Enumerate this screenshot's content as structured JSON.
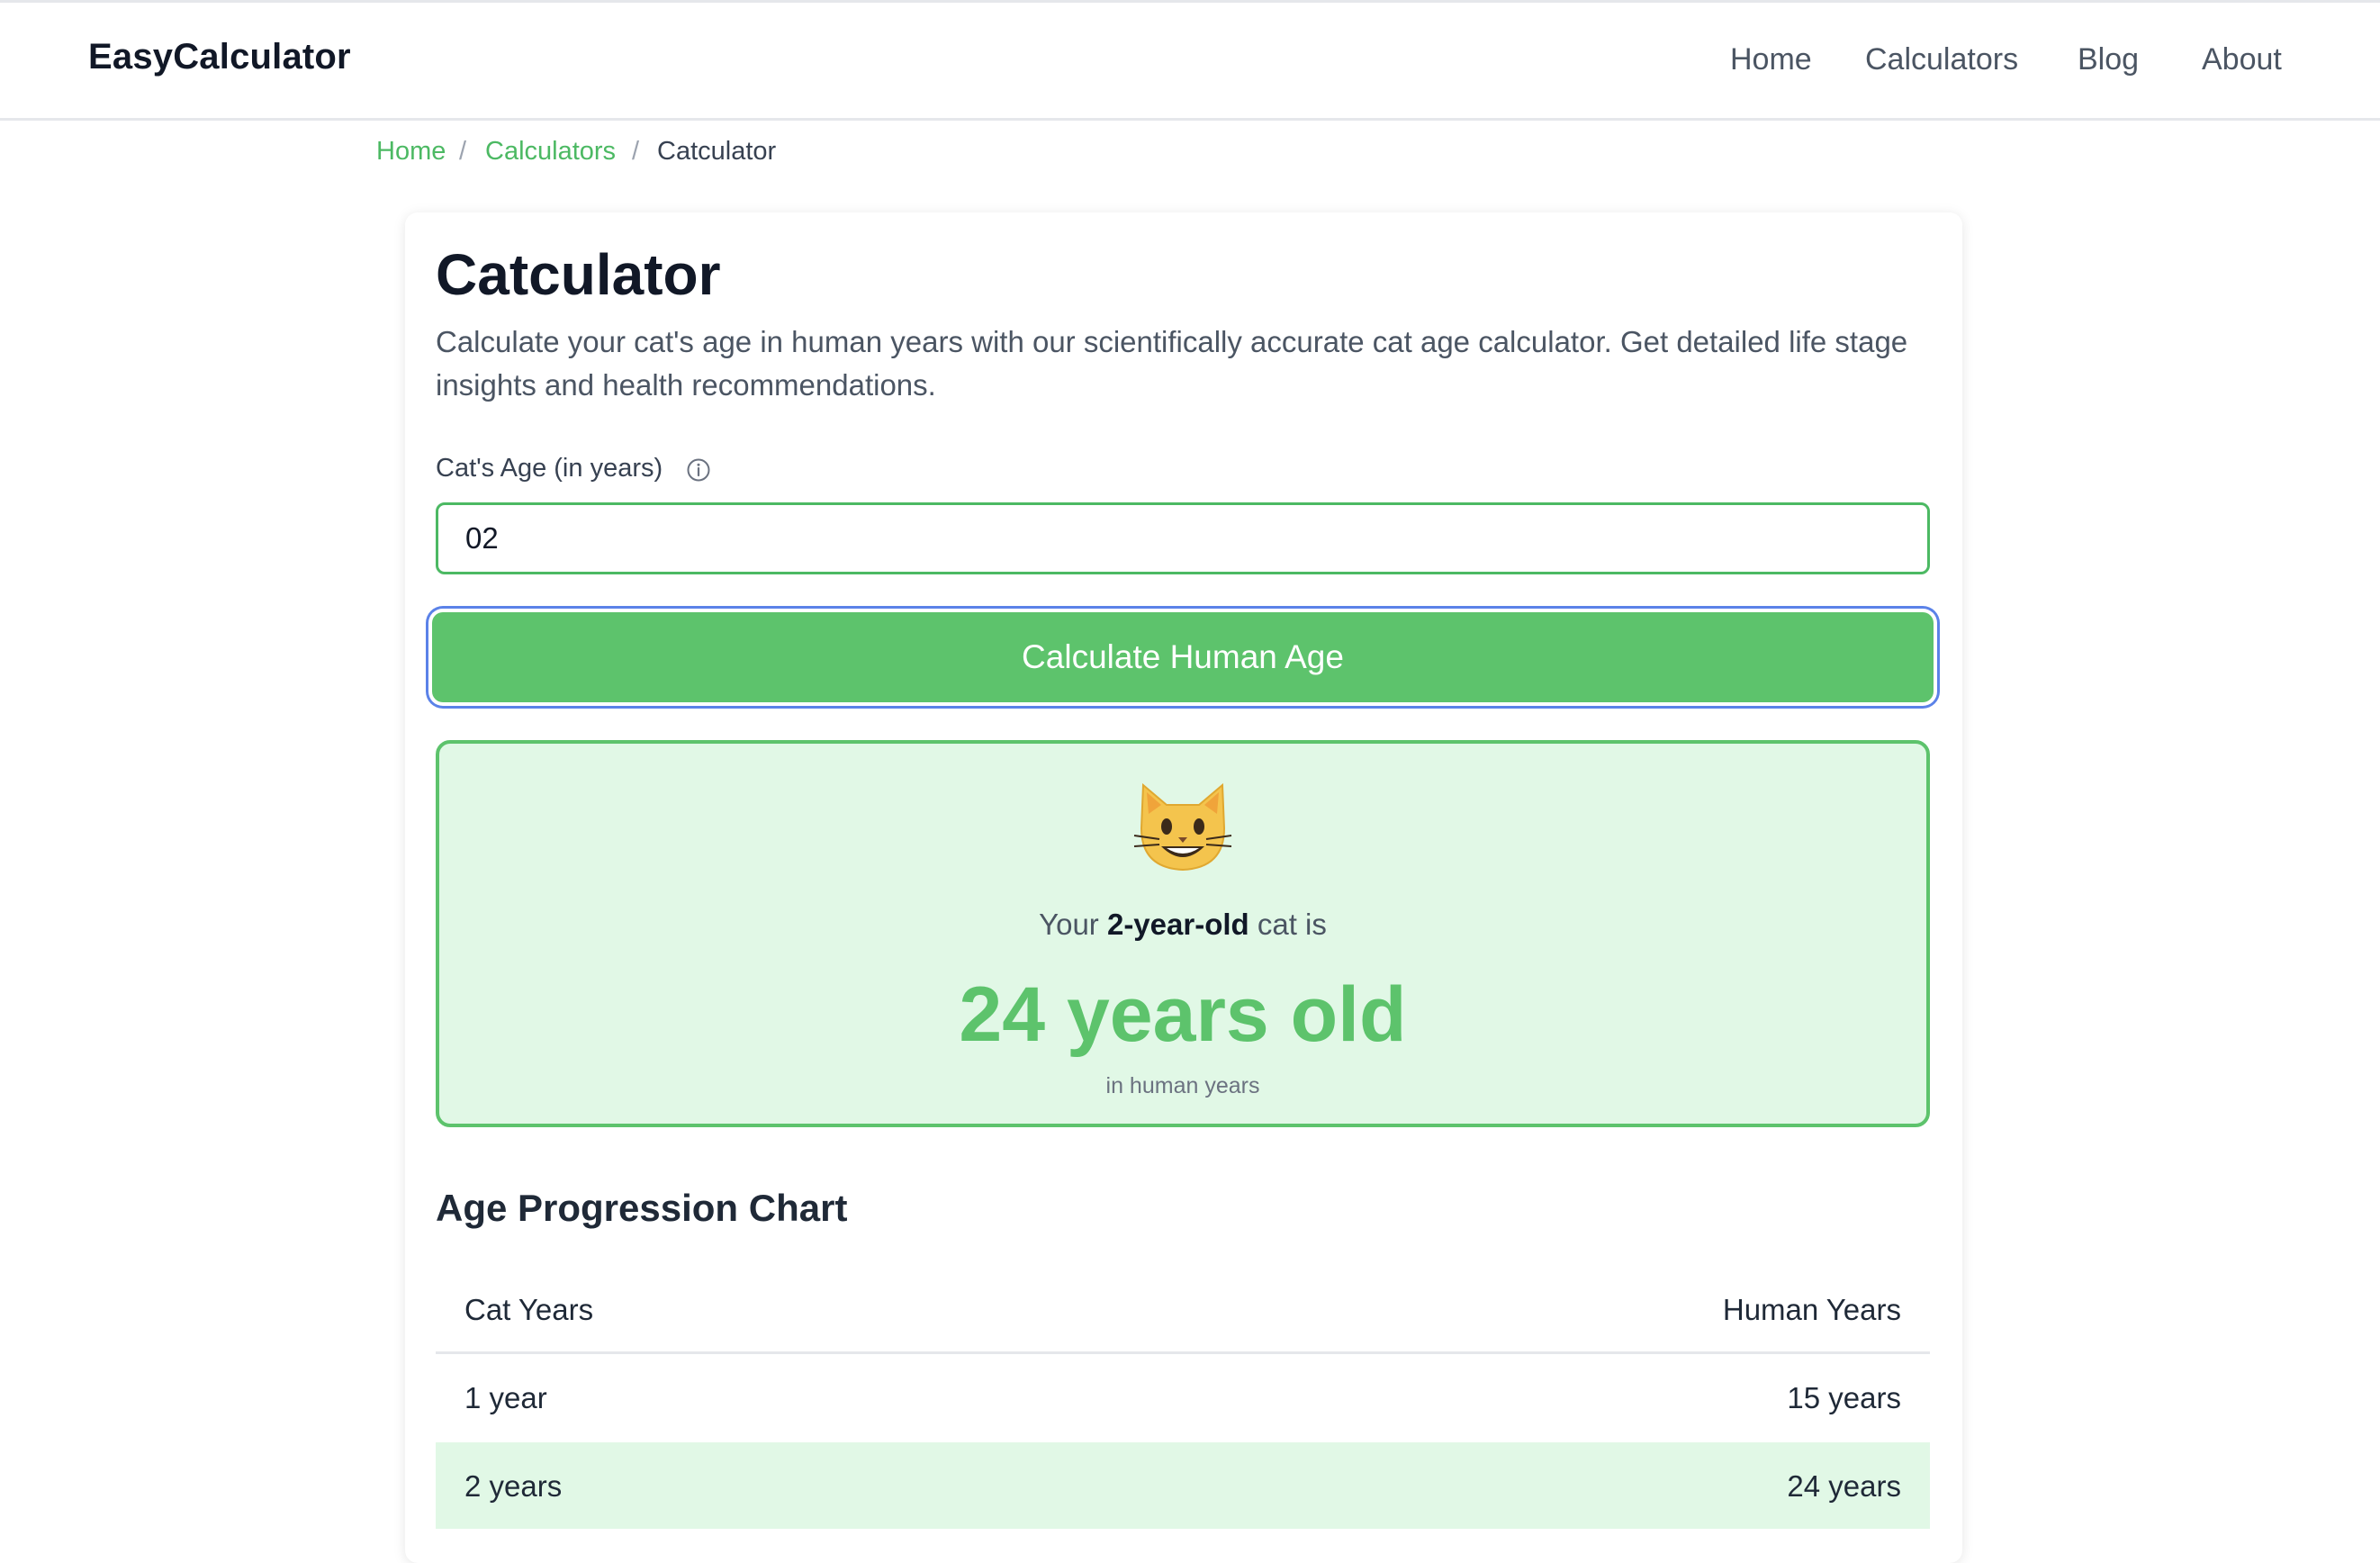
{
  "header": {
    "brand": "EasyCalculator",
    "nav": [
      "Home",
      "Calculators",
      "Blog",
      "About"
    ]
  },
  "breadcrumb": {
    "items": [
      "Home",
      "Calculators",
      "Catculator"
    ],
    "separator": "/"
  },
  "calculator": {
    "title": "Catculator",
    "description": "Calculate your cat's age in human years with our scientifically accurate cat age calculator. Get detailed life stage insights and health recommendations.",
    "field_label": "Cat's Age (in years)",
    "input_value": "02",
    "button_label": "Calculate Human Age"
  },
  "result": {
    "prefix": "Your",
    "cat_age": "2-year-old",
    "suffix": "cat is",
    "human_age": "24 years old",
    "unit_note": "in human years",
    "icon": "grinning-cat-icon"
  },
  "chart": {
    "title": "Age Progression Chart",
    "columns": [
      "Cat Years",
      "Human Years"
    ],
    "rows": [
      {
        "cat": "1 year",
        "human": "15 years",
        "highlight": false
      },
      {
        "cat": "2 years",
        "human": "24 years",
        "highlight": true
      }
    ]
  },
  "colors": {
    "accent": "#5dc36c",
    "link": "#4cb963",
    "result_bg": "#e1f8e6",
    "focus_ring": "#5b82e8"
  }
}
